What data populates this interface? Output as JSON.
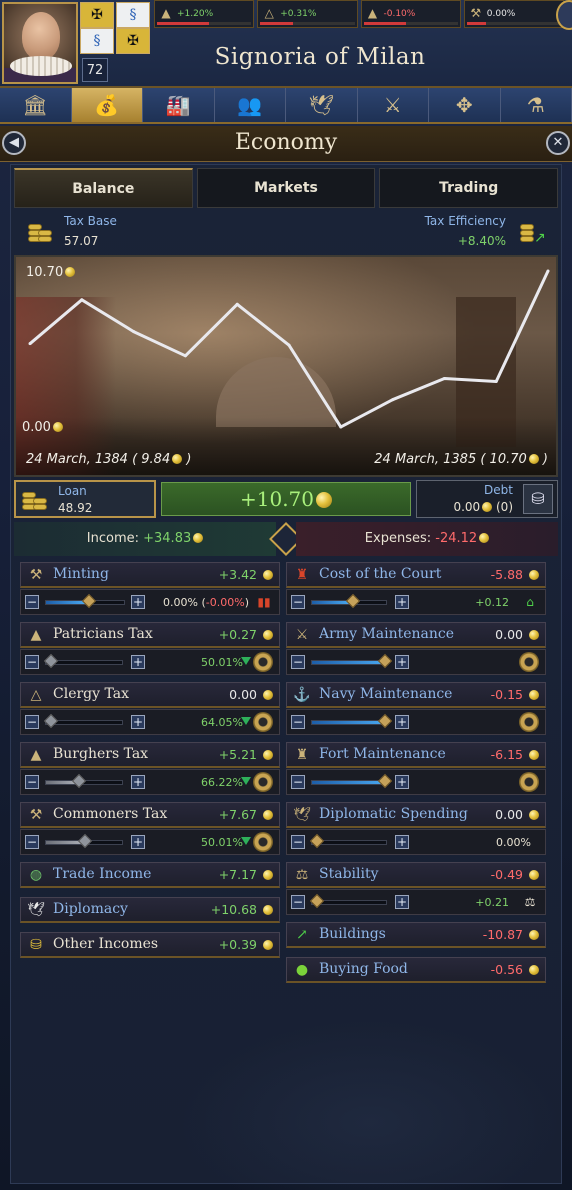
{
  "header": {
    "age": "72",
    "realm_name": "Signoria of Milan",
    "estates": [
      {
        "icon": "patricians-icon",
        "value": "+1.20%",
        "tone": "pos",
        "bar": 0.55,
        "bar_color": "#d23a3a"
      },
      {
        "icon": "clergy-icon",
        "value": "+0.31%",
        "tone": "pos",
        "bar": 0.35,
        "bar_color": "#d23a3a"
      },
      {
        "icon": "burghers-icon",
        "value": "-0.10%",
        "tone": "neg",
        "bar": 0.45,
        "bar_color": "#d23a3a"
      },
      {
        "icon": "commoners-icon",
        "value": "0.00%",
        "tone": "neu",
        "bar": 0.2,
        "bar_color": "#d23a3a"
      }
    ]
  },
  "category_tabs": [
    {
      "name": "government",
      "icon": "🏛",
      "active": false
    },
    {
      "name": "economy",
      "icon": "💰",
      "active": true
    },
    {
      "name": "buildings",
      "icon": "🏭",
      "active": false
    },
    {
      "name": "court",
      "icon": "👥",
      "active": false
    },
    {
      "name": "diplomacy",
      "icon": "🕊",
      "active": false
    },
    {
      "name": "military",
      "icon": "⚔",
      "active": false
    },
    {
      "name": "map",
      "icon": "✥",
      "active": false
    },
    {
      "name": "alchemy",
      "icon": "⚗",
      "active": false
    }
  ],
  "economy": {
    "title": "Economy",
    "tabs": [
      "Balance",
      "Markets",
      "Trading"
    ],
    "tax_base_label": "Tax Base",
    "tax_base_value": "57.07",
    "tax_eff_label": "Tax Efficiency",
    "tax_eff_value": "+8.40%"
  },
  "chart_data": {
    "type": "line",
    "y_max_label": "10.70",
    "y_min_label": "0.00",
    "start_label": "24 March, 1384 ( 9.84",
    "end_label": "24 March, 1385 ( 10.70",
    "ylim": [
      0,
      10.7
    ],
    "values": [
      5.9,
      8.8,
      6.7,
      5.1,
      8.5,
      5.8,
      0.4,
      2.2,
      3.6,
      3.4,
      10.7
    ],
    "line_color": "#e9e9ee"
  },
  "finance": {
    "loan_label": "Loan",
    "loan_value": "48.92",
    "balance": "+10.70",
    "debt_label": "Debt",
    "debt_value": "0.00",
    "debt_count": "(0)"
  },
  "summary": {
    "income_label": "Income:",
    "income_value": "+34.83",
    "expenses_label": "Expenses:",
    "expenses_value": "-24.12"
  },
  "income": {
    "minting": {
      "label": "Minting",
      "value": "+3.42",
      "ctrl_text": "0.00% (",
      "ctrl_neg": "-0.00%",
      "ctrl_close": ")"
    },
    "patricians": {
      "label": "Patricians Tax",
      "value": "+0.27",
      "pct": "50.01%"
    },
    "clergy": {
      "label": "Clergy Tax",
      "value": "0.00",
      "pct": "64.05%"
    },
    "burghers": {
      "label": "Burghers Tax",
      "value": "+5.21",
      "pct": "66.22%"
    },
    "commoners": {
      "label": "Commoners Tax",
      "value": "+7.67",
      "pct": "50.01%"
    },
    "trade": {
      "label": "Trade Income",
      "value": "+7.17"
    },
    "diplomacy": {
      "label": "Diplomacy",
      "value": "+10.68"
    },
    "other": {
      "label": "Other Incomes",
      "value": "+0.39"
    }
  },
  "expenses": {
    "court": {
      "label": "Cost of the Court",
      "value": "-5.88",
      "ctrl": "+0.12"
    },
    "army": {
      "label": "Army Maintenance",
      "value": "0.00"
    },
    "navy": {
      "label": "Navy Maintenance",
      "value": "-0.15"
    },
    "fort": {
      "label": "Fort Maintenance",
      "value": "-6.15"
    },
    "diplomatic": {
      "label": "Diplomatic Spending",
      "value": "0.00",
      "ctrl": "0.00%"
    },
    "stability": {
      "label": "Stability",
      "value": "-0.49",
      "ctrl": "+0.21"
    },
    "buildings": {
      "label": "Buildings",
      "value": "-10.87"
    },
    "food": {
      "label": "Buying Food",
      "value": "-0.56"
    }
  }
}
